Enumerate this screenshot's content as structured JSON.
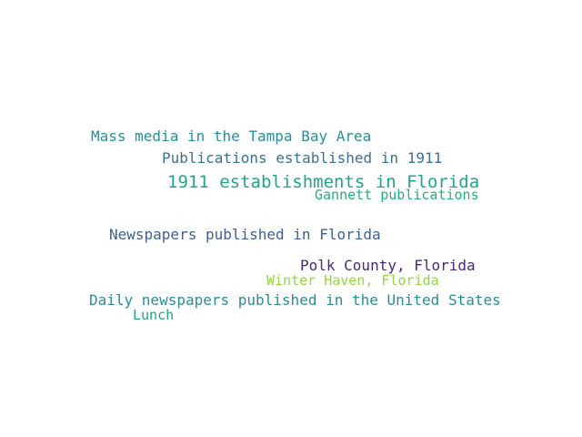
{
  "word_cloud": {
    "words": [
      {
        "text": "Mass media in the Tampa Bay Area",
        "color": "#2a8f9a"
      },
      {
        "text": "Publications established in 1911",
        "color": "#3b6f94"
      },
      {
        "text": "1911 establishments in Florida",
        "color": "#23a38c"
      },
      {
        "text": "Gannett publications",
        "color": "#27ad81"
      },
      {
        "text": "Newspapers published in Florida",
        "color": "#3d5f92"
      },
      {
        "text": "Polk County, Florida",
        "color": "#482878"
      },
      {
        "text": "Winter Haven, Florida",
        "color": "#93d741"
      },
      {
        "text": "Daily newspapers published in the United States",
        "color": "#2b8c94"
      },
      {
        "text": "Lunch",
        "color": "#20a486"
      }
    ]
  }
}
